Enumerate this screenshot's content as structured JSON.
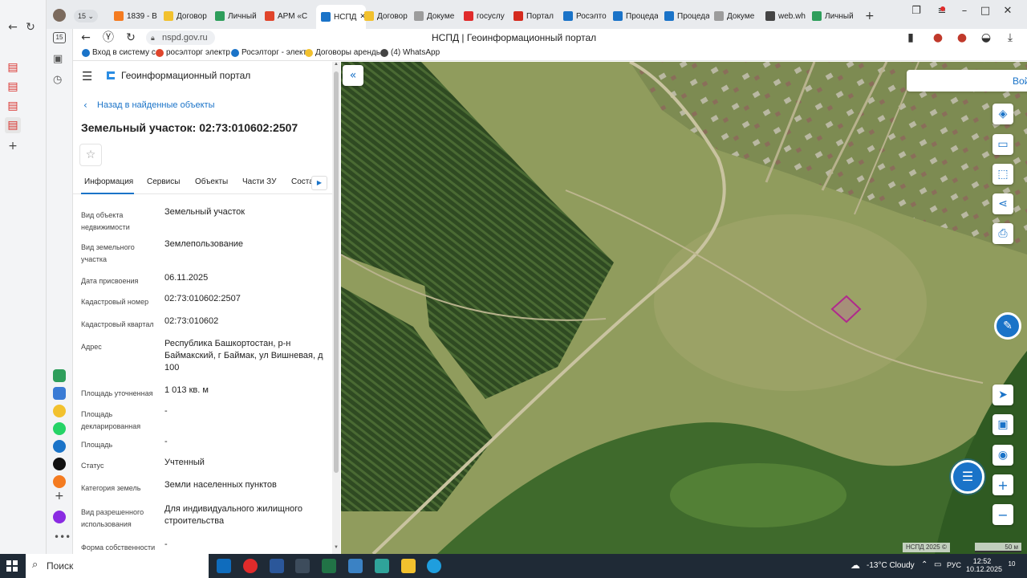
{
  "outer_strip": {
    "counter": "15"
  },
  "tabs": [
    {
      "label": "1839 - В",
      "color": "#f47b20"
    },
    {
      "label": "Договор",
      "color": "#f2c12e"
    },
    {
      "label": "Личный",
      "color": "#2e9e5b"
    },
    {
      "label": "АРМ «С",
      "color": "#e0452b"
    },
    {
      "label": "НСПД",
      "color": "#1a73c8",
      "active": true
    },
    {
      "label": "Договор",
      "color": "#f2c12e"
    },
    {
      "label": "Докуме",
      "color": "#9c9c9c"
    },
    {
      "label": "госуслу",
      "color": "#e02b2b"
    },
    {
      "label": "Портал",
      "color": "#d52b1e"
    },
    {
      "label": "Росэлто",
      "color": "#1a73c8"
    },
    {
      "label": "Процеда",
      "color": "#1a73c8"
    },
    {
      "label": "Процеда",
      "color": "#1a73c8"
    },
    {
      "label": "Докуме",
      "color": "#9c9c9c"
    },
    {
      "label": "web.wh",
      "color": "#444444"
    },
    {
      "label": "Личный",
      "color": "#2e9e5b"
    }
  ],
  "tab_counter": "15",
  "address": {
    "url": "nspd.gov.ru",
    "page_title": "НСПД | Геоинформационный портал"
  },
  "bookmarks": [
    {
      "label": "Вход в систему с к",
      "color": "#1a73c8"
    },
    {
      "label": "росэлторг электр",
      "color": "#e0452b"
    },
    {
      "label": "Росэлторг - электр",
      "color": "#1a73c8"
    },
    {
      "label": "Договоры арендь",
      "color": "#f2c12e"
    },
    {
      "label": "(4) WhatsApp",
      "color": "#444444"
    }
  ],
  "panel": {
    "portal_title": "Геоинформационный портал",
    "back_link": "Назад в найденные объекты",
    "title": "Земельный участок: 02:73:010602:2507",
    "tabs": [
      "Информация",
      "Сервисы",
      "Объекты",
      "Части ЗУ",
      "Состав"
    ],
    "rows": [
      {
        "label": "Вид объекта недвижимости",
        "value": "Земельный участок"
      },
      {
        "label": "Вид земельного участка",
        "value": "Землепользование"
      },
      {
        "label": "Дата присвоения",
        "value": "06.11.2025"
      },
      {
        "label": "Кадастровый номер",
        "value": "02:73:010602:2507"
      },
      {
        "label": "Кадастровый квартал",
        "value": "02:73:010602"
      },
      {
        "label": "Адрес",
        "value": "Республика Башкортостан, р-н Баймакский, г Баймак, ул Вишневая, д 100"
      },
      {
        "label": "Площадь уточненная",
        "value": "1 013 кв. м"
      },
      {
        "label": "Площадь декларированная",
        "value": "-"
      },
      {
        "label": "Площадь",
        "value": "-"
      },
      {
        "label": "Статус",
        "value": "Учтенный"
      },
      {
        "label": "Категория земель",
        "value": "Земли населенных пунктов"
      },
      {
        "label": "Вид разрешенного использования",
        "value": "Для индивидуального жилищного строительства"
      },
      {
        "label": "Форма собственности",
        "value": "-"
      }
    ]
  },
  "map": {
    "login": "Войти",
    "attribution": "НСПД 2025 ©",
    "scale": "50 м"
  },
  "taskbar": {
    "search": "Поиск",
    "weather": "-13°C Cloudy",
    "lang": "РУС",
    "time": "12:52",
    "date": "10.12.2025",
    "badge": "10"
  }
}
